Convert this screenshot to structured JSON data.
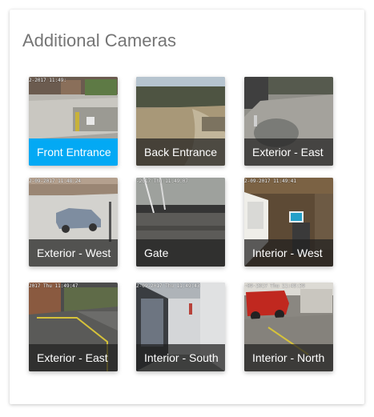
{
  "panel": {
    "title": "Additional Cameras"
  },
  "colors": {
    "active_label": "#03a9f4",
    "label_overlay": "rgba(32,32,32,0.72)",
    "title": "#757575"
  },
  "cameras": [
    {
      "label": "Front Entrance",
      "timestamp": "2-2017 11:49:",
      "selected": true
    },
    {
      "label": "Back Entrance",
      "timestamp": "",
      "selected": false
    },
    {
      "label": "Exterior - East",
      "timestamp": "",
      "selected": false
    },
    {
      "label": "Exterior - West",
      "timestamp": "2-09-2017 11:48:24",
      "selected": false
    },
    {
      "label": "Gate",
      "timestamp": "-2017 Thu 11:49:07",
      "selected": false
    },
    {
      "label": "Interior - West",
      "timestamp": "2-09-2017 11:49:41",
      "selected": false
    },
    {
      "label": "Exterior - East",
      "timestamp": "2017 Thu 11:49:47",
      "selected": false
    },
    {
      "label": "Interior - South",
      "timestamp": "2-09-2017 Thu 11:49:43",
      "selected": false
    },
    {
      "label": "Interior - North",
      "timestamp": "-09-2017 Thu 11:49:39",
      "selected": false
    }
  ]
}
